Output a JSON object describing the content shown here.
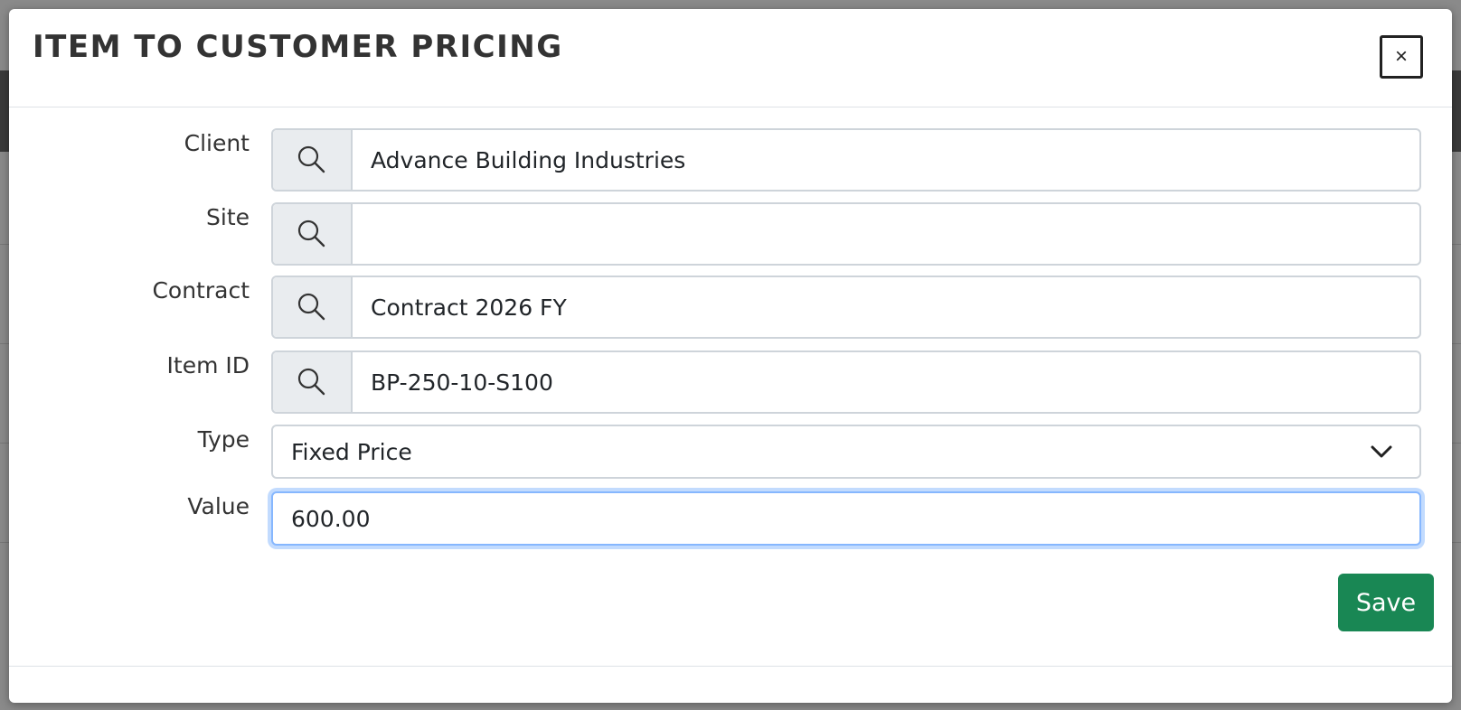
{
  "modal": {
    "title": "ITEM TO CUSTOMER PRICING",
    "close_label": "×"
  },
  "form": {
    "client": {
      "label": "Client",
      "value": "Advance Building Industries",
      "placeholder": ""
    },
    "site": {
      "label": "Site",
      "value": "",
      "placeholder": ""
    },
    "contract": {
      "label": "Contract",
      "value": "Contract 2026 FY",
      "placeholder": ""
    },
    "item_id": {
      "label": "Item ID",
      "value": "BP-250-10-S100",
      "placeholder": ""
    },
    "type": {
      "label": "Type",
      "selected": "Fixed Price"
    },
    "value": {
      "label": "Value",
      "value": "600.00"
    }
  },
  "actions": {
    "save_label": "Save"
  },
  "icons": {
    "lookup": "search-icon",
    "dropdown": "chevron-down-icon",
    "close": "close-icon"
  },
  "colors": {
    "save_button": "#198754",
    "focus_ring": "#86b7fe",
    "addon_bg": "#e9ecef"
  }
}
